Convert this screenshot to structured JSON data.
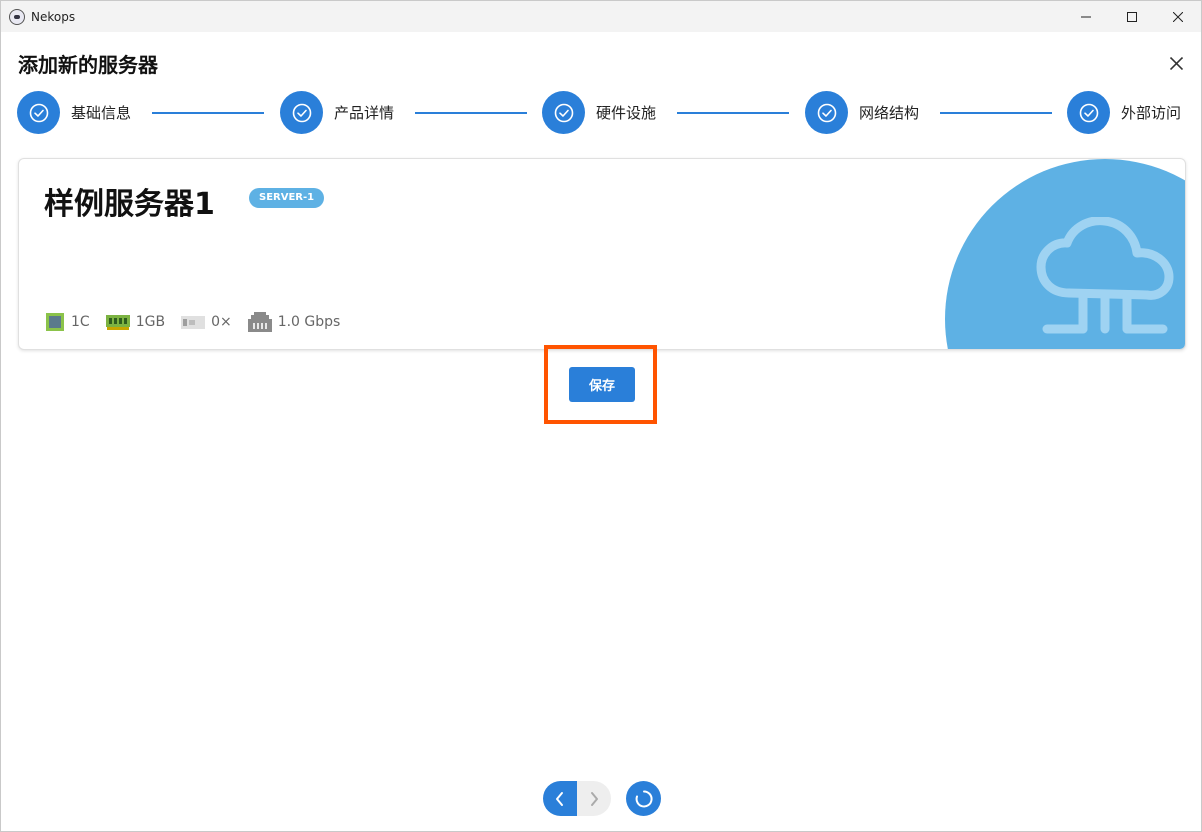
{
  "window": {
    "title": "Nekops"
  },
  "dialog": {
    "title": "添加新的服务器",
    "steps": [
      {
        "label": "基础信息",
        "status": "completed"
      },
      {
        "label": "产品详情",
        "status": "completed"
      },
      {
        "label": "硬件设施",
        "status": "completed"
      },
      {
        "label": "网络结构",
        "status": "completed"
      },
      {
        "label": "外部访问",
        "status": "completed"
      }
    ]
  },
  "server_card": {
    "name": "样例服务器1",
    "badge": "SERVER-1",
    "icon": "cloud-network-icon",
    "specs": {
      "cpu": {
        "icon": "cpu-icon",
        "value": "1C"
      },
      "memory": {
        "icon": "memory-icon",
        "value": "1GB"
      },
      "disk": {
        "icon": "disk-icon",
        "value": "0×"
      },
      "network": {
        "icon": "ethernet-port-icon",
        "value": "1.0 Gbps"
      }
    }
  },
  "actions": {
    "save_label": "保存"
  },
  "colors": {
    "accent": "#2a7fd9",
    "card_accent": "#5eb1e4",
    "highlight": "#ff5400"
  }
}
